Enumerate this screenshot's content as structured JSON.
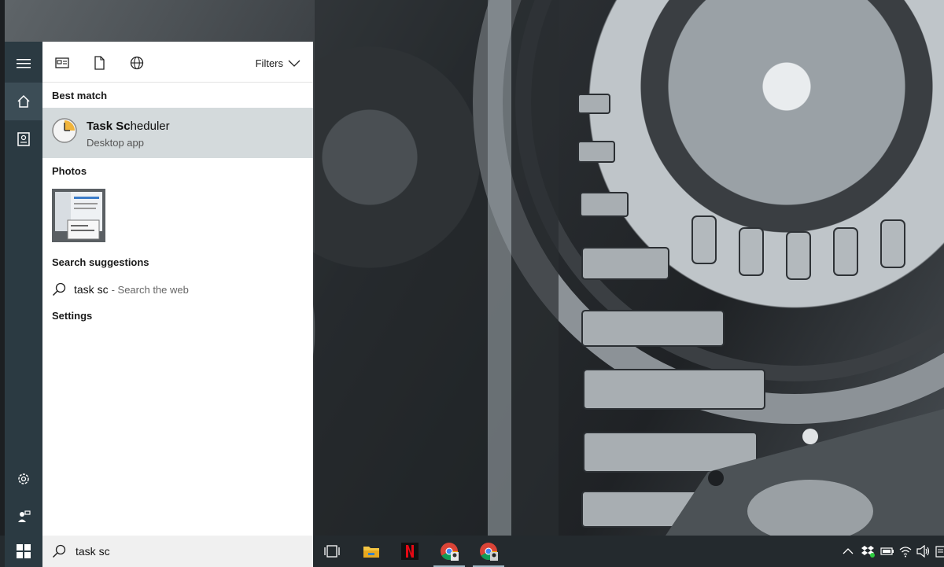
{
  "rail": {
    "items": [
      {
        "name": "menu"
      },
      {
        "name": "home"
      },
      {
        "name": "notebook"
      },
      {
        "name": "settings"
      },
      {
        "name": "feedback"
      }
    ]
  },
  "panel": {
    "filters_label": "Filters",
    "best_match": {
      "heading": "Best match",
      "app_name_bold": "Task Sc",
      "app_name_rest": "heduler",
      "app_type": "Desktop app"
    },
    "photos": {
      "heading": "Photos"
    },
    "suggestions": {
      "heading": "Search suggestions",
      "query": "task sc",
      "suffix": "- Search the web"
    },
    "settings": {
      "heading": "Settings"
    }
  },
  "taskbar": {
    "search_value": "task sc",
    "apps": [
      "task-view",
      "file-explorer",
      "netflix",
      "chrome",
      "chrome"
    ]
  },
  "colors": {
    "rail": "#2b3a42",
    "selected": "#d4dadc",
    "taskbar": "#242a2e"
  }
}
